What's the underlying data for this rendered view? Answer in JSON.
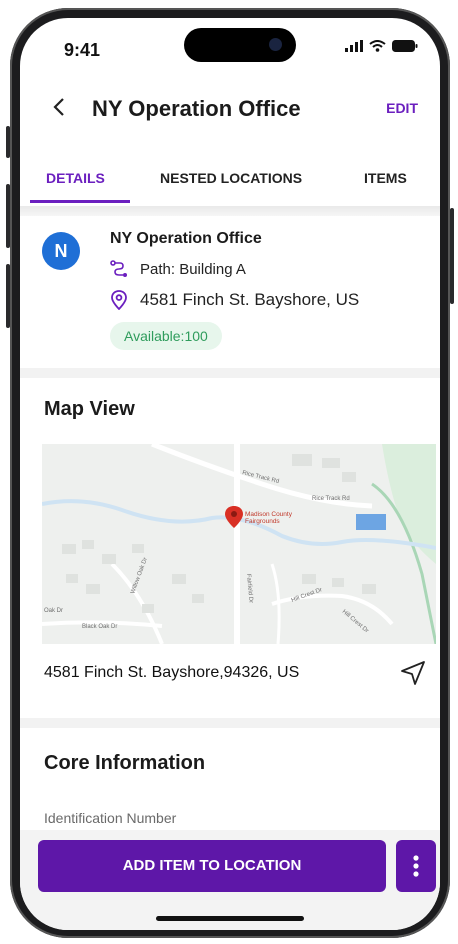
{
  "status_bar": {
    "time": "9:41"
  },
  "header": {
    "title": "NY Operation Office",
    "edit_label": "EDIT"
  },
  "tabs": [
    {
      "label": "DETAILS",
      "active": true
    },
    {
      "label": "NESTED LOCATIONS",
      "active": false
    },
    {
      "label": "ITEMS",
      "active": false
    }
  ],
  "location": {
    "avatar_initial": "N",
    "name": "NY Operation Office",
    "path": "Path: Building A",
    "address": "4581 Finch St. Bayshore, US",
    "availability": "Available:100"
  },
  "map_view": {
    "title": "Map View",
    "marker_label_line1": "Madison County",
    "marker_label_line2": "Fairgrounds",
    "roads": [
      "Rice Track Rd",
      "Rice Track Rd",
      "Fairfield Dr",
      "Hill Crest Dr",
      "Hill Crest Dr",
      "Willow Oak Dr",
      "Black Oak Dr",
      "Oak Dr"
    ],
    "full_address": "4581 Finch St. Bayshore,94326, US"
  },
  "core_information": {
    "title": "Core Information",
    "identification_label": "Identification Number"
  },
  "actions": {
    "add_item_label": "ADD ITEM TO LOCATION"
  },
  "colors": {
    "accent": "#6b1fbf",
    "button": "#5e17a8",
    "avatar": "#1f6fd6",
    "available_bg": "#e7f6ec",
    "available_text": "#2f9c5c"
  },
  "icons": {
    "back": "chevron-left-icon",
    "path": "route-icon",
    "address": "location-pin-icon",
    "navigate": "navigation-arrow-icon",
    "more": "more-vertical-icon"
  }
}
